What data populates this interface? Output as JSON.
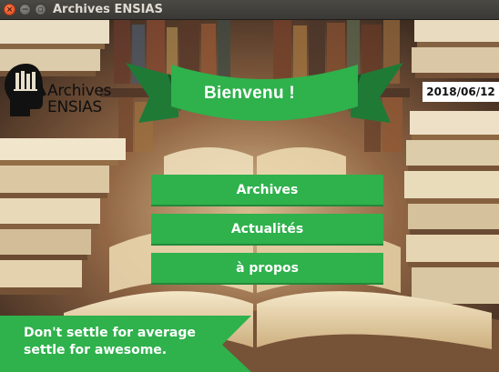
{
  "window": {
    "title": "Archives ENSIAS",
    "controls": {
      "close": "×",
      "minimize": "−",
      "maximize": "▫"
    }
  },
  "logo": {
    "line1": "Archives",
    "line2": "ENSIAS",
    "icon": "head-with-books-icon"
  },
  "banner": {
    "text": "Bienvenu !"
  },
  "date": "2018/06/12",
  "menu": {
    "archives": "Archives",
    "actualites": "Actualités",
    "apropos": "à propos"
  },
  "footer": {
    "line1": "Don't settle for average",
    "line2": "settle for awesome."
  },
  "colors": {
    "accent_green": "#2fb14c",
    "ribbon_dark": "#1f7a36"
  }
}
